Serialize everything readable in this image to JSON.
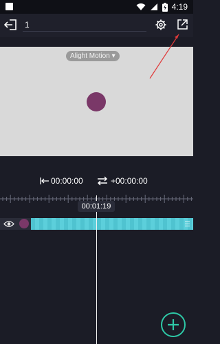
{
  "status_bar": {
    "time": "4:19"
  },
  "toolbar": {
    "project_name": "1"
  },
  "preview": {
    "watermark_label": "Alight Motion ▾"
  },
  "timeline": {
    "start_time": "00:00:00",
    "loop_time": "+00:00:00",
    "current_time": "00:01:19"
  },
  "icons": {
    "exit": "exit-icon",
    "settings": "gear-icon",
    "share": "share-export-icon",
    "eye": "eye-icon",
    "add": "plus-icon"
  },
  "colors": {
    "background": "#1b1c26",
    "canvas": "#d9d9d9",
    "shape": "#7a3868",
    "track": "#4fc3d0",
    "accent": "#2ec9a7",
    "arrow": "#e03a3a"
  }
}
